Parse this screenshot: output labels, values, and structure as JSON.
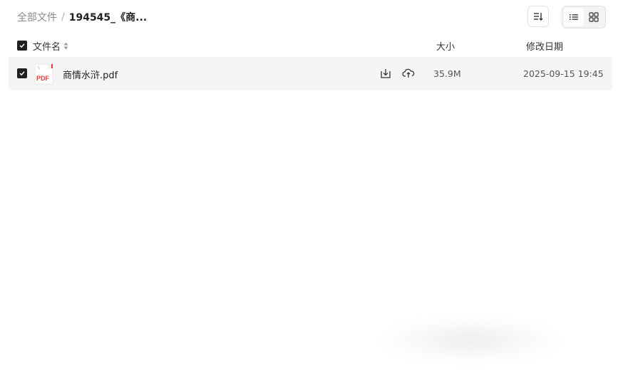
{
  "breadcrumb": {
    "root": "全部文件",
    "separator": "/",
    "current": "194545_《商..."
  },
  "toolbar": {
    "sort_icon": "sort-icon",
    "list_view_icon": "list-view-icon",
    "grid_view_icon": "grid-view-icon",
    "active_view": "list"
  },
  "table": {
    "columns": {
      "name": "文件名",
      "size": "大小",
      "date": "修改日期"
    },
    "rows": [
      {
        "icon": "pdf-file-icon",
        "icon_label": "PDF",
        "name": "商情水浒.pdf",
        "size": "35.9M",
        "modified": "2025-09-15 19:45",
        "selected": true
      }
    ]
  },
  "colors": {
    "pdf_red": "#e53935",
    "row_bg": "#f5f5f5",
    "checkbox": "#1f1f1f"
  }
}
